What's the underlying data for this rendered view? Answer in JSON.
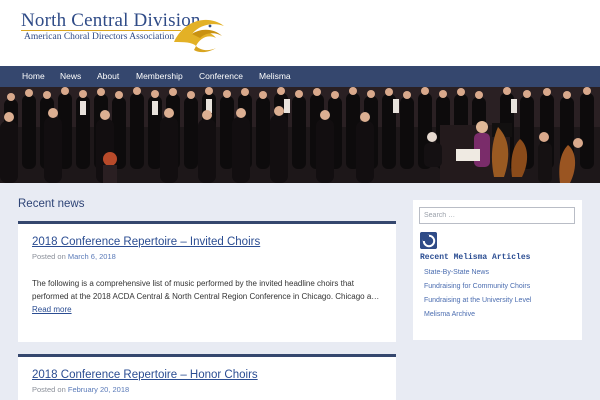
{
  "header": {
    "site_title": "North Central Division",
    "site_subtitle": "American Choral Directors Association"
  },
  "nav": {
    "items": [
      "Home",
      "News",
      "About",
      "Membership",
      "Conference",
      "Melisma"
    ]
  },
  "main": {
    "section_title": "Recent news",
    "posts": [
      {
        "title": "2018 Conference Repertoire – Invited Choirs",
        "posted_prefix": "Posted on",
        "date": "March 6, 2018",
        "excerpt": "The following is a comprehensive list of music performed by the invited headline choirs that performed at the 2018 ACDA Central & North Central Region Conference in Chicago. Chicago a…",
        "read_more": "Read more"
      },
      {
        "title": "2018 Conference Repertoire – Honor Choirs",
        "posted_prefix": "Posted on",
        "date": "February 20, 2018"
      }
    ]
  },
  "sidebar": {
    "search_placeholder": "Search …",
    "widget_title": "Recent Melisma Articles",
    "links": [
      "State-By-State News",
      "Fundraising for Community Choirs",
      "Fundraising at the University Level",
      "Melisma Archive"
    ]
  },
  "colors": {
    "brand_blue": "#2f4b87",
    "nav_background": "#35476e",
    "logo_gold": "#d9a520",
    "page_background": "#e8ebf3"
  }
}
